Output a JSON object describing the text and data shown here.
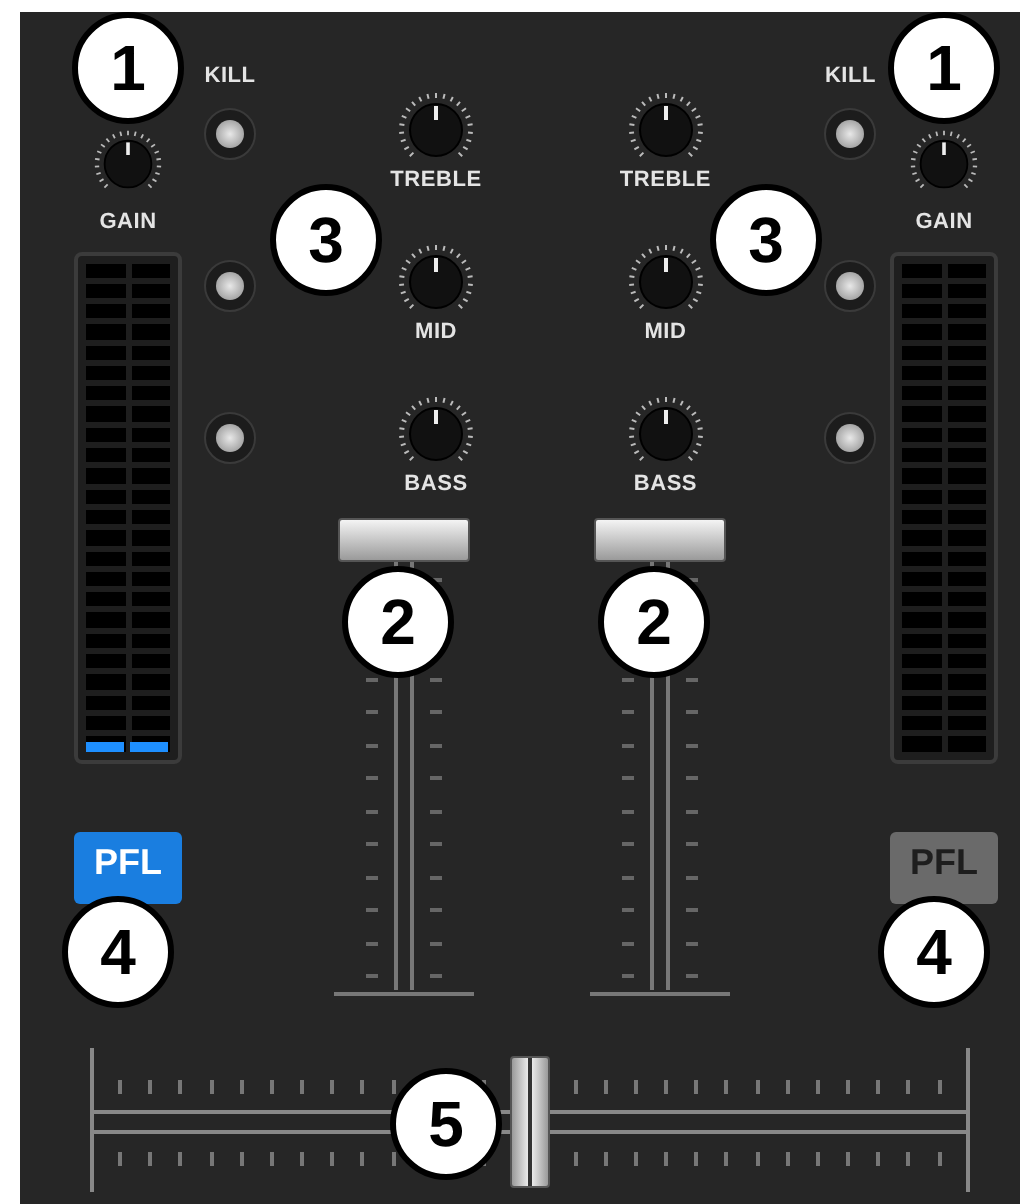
{
  "channels": [
    {
      "gain": {
        "label": "GAIN",
        "callout": "1"
      },
      "meter": {
        "level": 0.02
      },
      "kill_label": "KILL",
      "eq": [
        {
          "label": "TREBLE",
          "kill_on": false
        },
        {
          "label": "MID",
          "kill_on": false
        },
        {
          "label": "BASS",
          "kill_on": false
        }
      ],
      "eq_callout": "3",
      "fader": {
        "level": 1,
        "callout": "2"
      },
      "pfl": {
        "label": "PFL",
        "on": true,
        "callout": "4"
      }
    },
    {
      "gain": {
        "label": "GAIN",
        "callout": "1"
      },
      "meter": {
        "level": 0
      },
      "kill_label": "KILL",
      "eq": [
        {
          "label": "TREBLE",
          "kill_on": false
        },
        {
          "label": "MID",
          "kill_on": false
        },
        {
          "label": "BASS",
          "kill_on": false
        }
      ],
      "eq_callout": "3",
      "fader": {
        "level": 1,
        "callout": "2"
      },
      "pfl": {
        "label": "PFL",
        "on": false,
        "callout": "4"
      }
    }
  ],
  "crossfader": {
    "level": 0.5,
    "callout": "5"
  }
}
